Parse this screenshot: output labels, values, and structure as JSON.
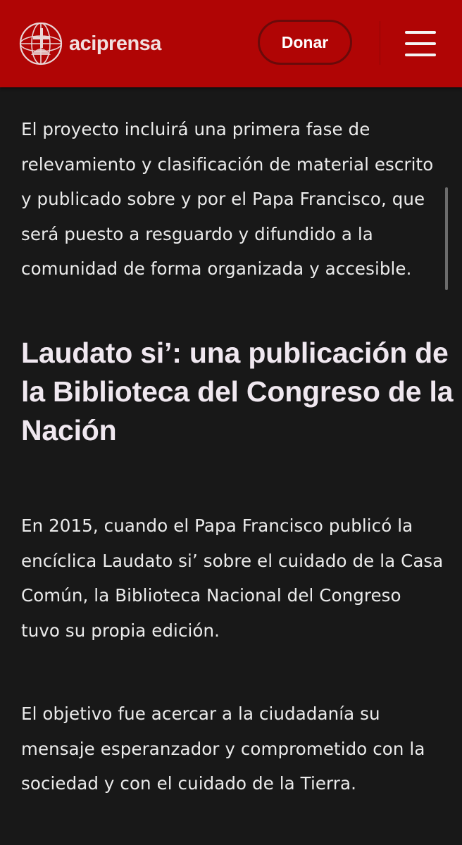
{
  "header": {
    "brand": "aciprensa",
    "donate_label": "Donar",
    "colors": {
      "bar": "#b00505",
      "donate_border": "#6a0a0a"
    }
  },
  "icons": {
    "logo": "aciprensa-globe-logo",
    "menu": "hamburger-menu-icon"
  },
  "article": {
    "intro": "El proyecto incluirá una primera fase de relevamiento y clasificación de material escrito y publicado sobre y por el Papa Francisco, que será puesto a resguardo y difundido a la comunidad de forma organizada y accesible.",
    "heading": "Laudato si’: una publicación de la Biblioteca del Congreso de la Nación",
    "paragraph_2": "En 2015, cuando el Papa Francisco publicó la encíclica Laudato si’ sobre el cuidado de la Casa Común, la Biblioteca Nacional del Congreso tuvo su propia edición.",
    "paragraph_3": "El objetivo fue acercar a la ciudadanía su mensaje esperanzador y comprometido con la sociedad y con el cuidado de la Tierra."
  },
  "theme": {
    "background": "#181818",
    "text": "#ebebeb",
    "heading": "#f0e8f0"
  }
}
